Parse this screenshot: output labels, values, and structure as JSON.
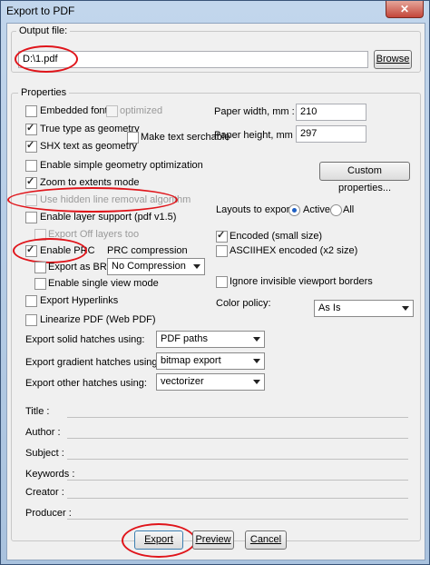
{
  "window": {
    "title": "Export to PDF",
    "close_glyph": "✕"
  },
  "output": {
    "label": "Output file:",
    "value": "D:\\1.pdf",
    "browse": "Browse"
  },
  "properties": {
    "title": "Properties",
    "embedded_fonts": "Embedded fonts",
    "optimized": "optimized",
    "true_type": "True type as geometry",
    "make_searchable": "Make text serchable",
    "shx_text": "SHX text as geometry",
    "simple_geom": "Enable simple geometry optimization",
    "zoom_extents": "Zoom to extents mode",
    "hidden_line": "Use hidden line removal algorithm",
    "layer_support": "Enable layer support (pdf v1.5)",
    "export_off_layers": "Export Off layers too",
    "enable_prc": "Enable PRC",
    "prc_compression": "PRC compression",
    "export_brep": "Export as BRep",
    "compression_value": "No Compression",
    "single_view": "Enable single view mode",
    "hyperlinks": "Export Hyperlinks",
    "linearize": "Linearize PDF (Web PDF)",
    "paper_width_label": "Paper width, mm :",
    "paper_width": "210",
    "paper_height_label": "Paper height, mm :",
    "paper_height": "297",
    "custom_properties": "Custom properties...",
    "layouts_label": "Layouts to export :",
    "active": "Active",
    "all": "All",
    "encoded": "Encoded (small size)",
    "asciihex": "ASCIIHEX encoded (x2 size)",
    "ignore_borders": "Ignore invisible viewport borders",
    "color_policy_label": "Color policy:",
    "color_policy": "As Is",
    "solid_label": "Export solid hatches using:",
    "solid_value": "PDF paths",
    "gradient_label": "Export gradient hatches using:",
    "gradient_value": "bitmap export",
    "other_label": "Export other hatches using:",
    "other_value": "vectorizer"
  },
  "meta": {
    "title": "Title :",
    "author": "Author :",
    "subject": "Subject :",
    "keywords": "Keywords :",
    "creator": "Creator :",
    "producer": "Producer :"
  },
  "buttons": {
    "export": "Export",
    "preview": "Preview",
    "cancel": "Cancel"
  },
  "colors": {
    "annotation": "#e0141a",
    "titlebar": "#b9cfe8"
  }
}
